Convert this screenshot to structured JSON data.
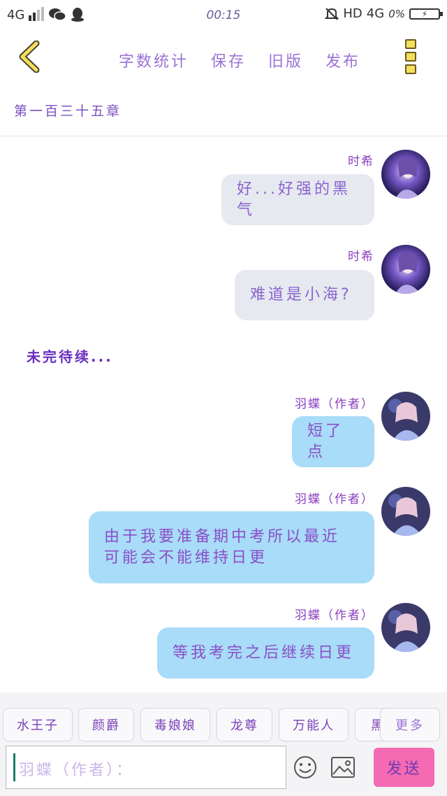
{
  "status_bar": {
    "network_left": "4G",
    "time": "00:15",
    "hd": "HD",
    "network_right": "4G",
    "battery": "0%"
  },
  "toolbar": {
    "items": [
      "字数统计",
      "保存",
      "旧版",
      "发布"
    ]
  },
  "chapter_title": "第一百三十五章",
  "messages": [
    {
      "name": "时希",
      "text": "好...好强的黑气"
    },
    {
      "name": "时希",
      "text": "难道是小海?"
    },
    {
      "name": "羽蝶（作者）",
      "text": "短了点"
    },
    {
      "name": "羽蝶（作者）",
      "text_lines": [
        "由于我要准备期中考所以最近",
        "可能会不能维持日更"
      ]
    },
    {
      "name": "羽蝶（作者）",
      "text": "等我考完之后继续日更"
    }
  ],
  "to_be_continued": "未完待续...",
  "chips": [
    "水王子",
    "颜爵",
    "毒娘娘",
    "龙尊",
    "万能人",
    "黑"
  ],
  "more_chip": "更多",
  "input": {
    "placeholder": "羽蝶（作者）："
  },
  "send_label": "发送",
  "colors": {
    "accent": "#9b72d6",
    "gray_bubble": "#e6e9f0",
    "blue_bubble": "#a8dcf8",
    "send": "#f46ab3"
  }
}
